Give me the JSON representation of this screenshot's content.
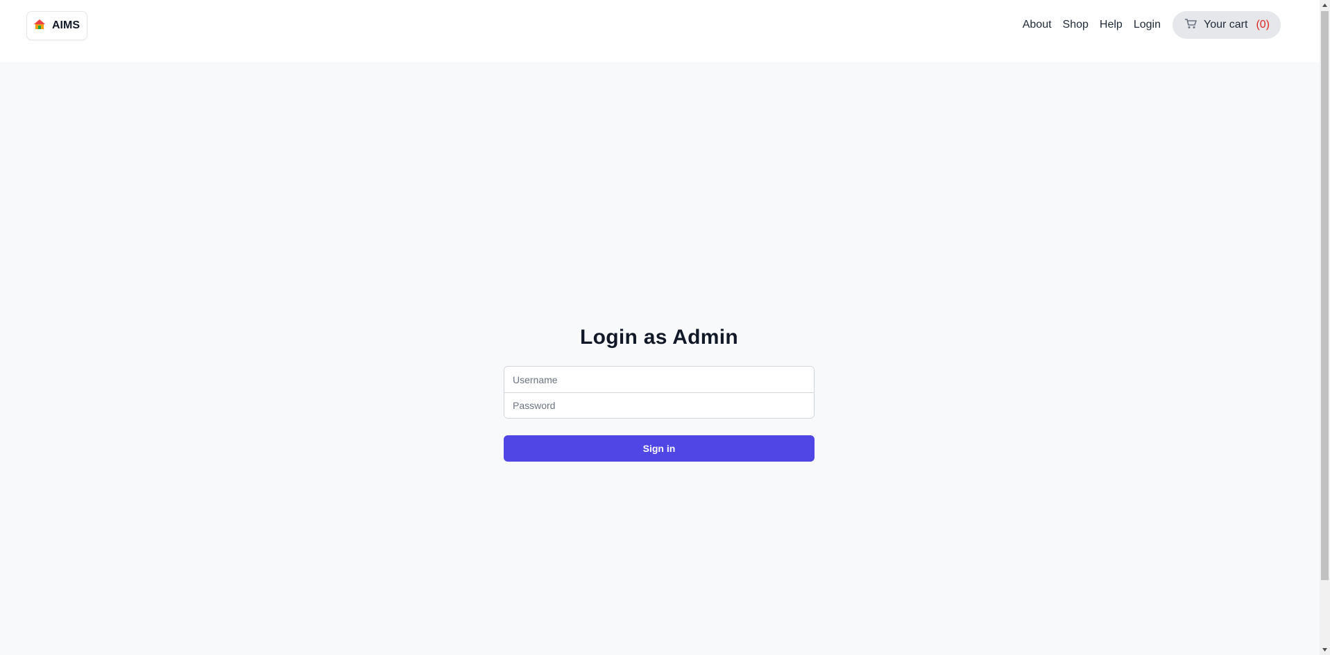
{
  "header": {
    "brand": {
      "icon": "house-icon",
      "label": "AIMS"
    },
    "nav": {
      "about": "About",
      "shop": "Shop",
      "help": "Help",
      "login": "Login"
    },
    "cart": {
      "icon": "cart-icon",
      "label": "Your cart",
      "count": "(0)"
    }
  },
  "login": {
    "title": "Login as Admin",
    "username": {
      "value": "",
      "placeholder": "Username"
    },
    "password": {
      "value": "",
      "placeholder": "Password"
    },
    "submit_label": "Sign in"
  },
  "colors": {
    "page_background": "#f8f9fa",
    "header_background": "#ffffff",
    "accent": "#4f46e5",
    "cart_count": "#dc2626",
    "cart_background": "#e5e7eb"
  }
}
